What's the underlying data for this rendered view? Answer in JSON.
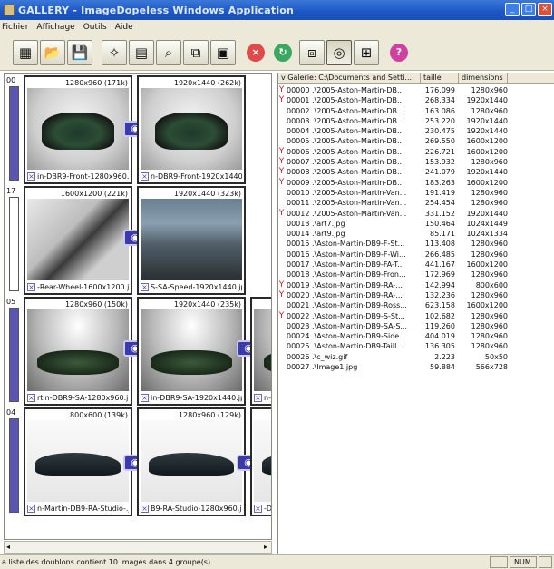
{
  "window": {
    "title": "GALLERY - ImageDopeless Windows Application",
    "buttons": [
      "_",
      "□",
      "×"
    ]
  },
  "menu": [
    "Fichier",
    "Affichage",
    "Outils",
    "Aide"
  ],
  "toolbar": {
    "icons": [
      "new-icon",
      "open-folder-icon",
      "save-disk-icon",
      "wand-icon",
      "image-list-icon",
      "find-icon",
      "compare-icon",
      "slideshow-icon",
      "stop-icon",
      "refresh-icon",
      "view-pair-icon",
      "view-glasses-icon",
      "view-mark-icon",
      "help-icon"
    ]
  },
  "groups": [
    {
      "number": "00",
      "bar_filled": true,
      "thumbs": [
        {
          "dim": "1280x960 (171k)",
          "fname": "in-DBR9-Front-1280x960.jpg",
          "img": "studio-car"
        },
        {
          "dim": "1920x1440 (262k)",
          "fname": "n-DBR9-Front-1920x1440.jpg",
          "img": "studio-car"
        }
      ]
    },
    {
      "number": "17",
      "bar_filled": false,
      "thumbs": [
        {
          "dim": "1600x1200 (221k)",
          "fname": "-Rear-Wheel-1600x1200.jpg",
          "img": "wheel"
        },
        {
          "dim": "1920x1440 (323k)",
          "fname": "S-SA-Speed-1920x1440.jpg",
          "img": "road"
        }
      ]
    },
    {
      "number": "05",
      "bar_filled": true,
      "thumbs": [
        {
          "dim": "1280x960 (150k)",
          "fname": "rtin-DBR9-SA-1280x960.jpg",
          "img": "sa"
        },
        {
          "dim": "1920x1440 (235k)",
          "fname": "in-DBR9-SA-1920x1440.jpg",
          "img": "sa"
        },
        {
          "dim": "",
          "fname": "n-DI",
          "img": "sa"
        }
      ]
    },
    {
      "number": "04",
      "bar_filled": true,
      "thumbs": [
        {
          "dim": "800x600 (139k)",
          "fname": "n-Martin-DB9-RA-Studio-.jpg",
          "img": "side-car"
        },
        {
          "dim": "1280x960 (129k)",
          "fname": "B9-RA-Studio-1280x960.jpg",
          "img": "side-car"
        },
        {
          "dim": "",
          "fname": "-DB",
          "img": "side-car"
        }
      ]
    }
  ],
  "table": {
    "headers": [
      "Galerie: C:\\Documents and Setti...",
      "taille",
      "dimensions"
    ],
    "rows": [
      {
        "chk": "Y",
        "num": "00000",
        "path": ".\\2005-Aston-Martin-DB...",
        "size": "176.099",
        "dim": "1280x960"
      },
      {
        "chk": "Y",
        "num": "00001",
        "path": ".\\2005-Aston-Martin-DB...",
        "size": "268.334",
        "dim": "1920x1440"
      },
      {
        "chk": "",
        "num": "00002",
        "path": ".\\2005-Aston-Martin-DB...",
        "size": "163.086",
        "dim": "1280x960"
      },
      {
        "chk": "",
        "num": "00003",
        "path": ".\\2005-Aston-Martin-DB...",
        "size": "253.220",
        "dim": "1920x1440"
      },
      {
        "chk": "",
        "num": "00004",
        "path": ".\\2005-Aston-Martin-DB...",
        "size": "230.475",
        "dim": "1920x1440"
      },
      {
        "chk": "",
        "num": "00005",
        "path": ".\\2005-Aston-Martin-DB...",
        "size": "269.550",
        "dim": "1600x1200"
      },
      {
        "chk": "Y",
        "num": "00006",
        "path": ".\\2005-Aston-Martin-DB...",
        "size": "226.721",
        "dim": "1600x1200"
      },
      {
        "chk": "Y",
        "num": "00007",
        "path": ".\\2005-Aston-Martin-DB...",
        "size": "153.932",
        "dim": "1280x960"
      },
      {
        "chk": "Y",
        "num": "00008",
        "path": ".\\2005-Aston-Martin-DB...",
        "size": "241.079",
        "dim": "1920x1440"
      },
      {
        "chk": "Y",
        "num": "00009",
        "path": ".\\2005-Aston-Martin-DB...",
        "size": "183.263",
        "dim": "1600x1200"
      },
      {
        "chk": "",
        "num": "00010",
        "path": ".\\2005-Aston-Martin-Van...",
        "size": "191.419",
        "dim": "1280x960"
      },
      {
        "chk": "",
        "num": "00011",
        "path": ".\\2005-Aston-Martin-Van...",
        "size": "254.454",
        "dim": "1280x960"
      },
      {
        "chk": "Y",
        "num": "00012",
        "path": ".\\2005-Aston-Martin-Van...",
        "size": "331.152",
        "dim": "1920x1440"
      },
      {
        "chk": "",
        "num": "00013",
        "path": ".\\art7.jpg",
        "size": "150.464",
        "dim": "1024x1449"
      },
      {
        "chk": "",
        "num": "00014",
        "path": ".\\art9.jpg",
        "size": "85.171",
        "dim": "1024x1334"
      },
      {
        "chk": "",
        "num": "00015",
        "path": ".\\Aston-Martin-DB9-F-St...",
        "size": "113.408",
        "dim": "1280x960"
      },
      {
        "chk": "",
        "num": "00016",
        "path": ".\\Aston-Martin-DB9-F-Wi...",
        "size": "266.485",
        "dim": "1280x960"
      },
      {
        "chk": "",
        "num": "00017",
        "path": ".\\Aston-Martin-DB9-FA-T...",
        "size": "441.167",
        "dim": "1600x1200"
      },
      {
        "chk": "",
        "num": "00018",
        "path": ".\\Aston-Martin-DB9-Fron...",
        "size": "172.969",
        "dim": "1280x960"
      },
      {
        "chk": "Y",
        "num": "00019",
        "path": ".\\Aston-Martin-DB9-RA-...",
        "size": "142.994",
        "dim": "800x600"
      },
      {
        "chk": "Y",
        "num": "00020",
        "path": ".\\Aston-Martin-DB9-RA-...",
        "size": "132.236",
        "dim": "1280x960"
      },
      {
        "chk": "",
        "num": "00021",
        "path": ".\\Aston-Martin-DB9-Ross...",
        "size": "623.158",
        "dim": "1600x1200"
      },
      {
        "chk": "Y",
        "num": "00022",
        "path": ".\\Aston-Martin-DB9-S-St...",
        "size": "102.682",
        "dim": "1280x960"
      },
      {
        "chk": "",
        "num": "00023",
        "path": ".\\Aston-Martin-DB9-SA-S...",
        "size": "119.260",
        "dim": "1280x960"
      },
      {
        "chk": "",
        "num": "00024",
        "path": ".\\Aston-Martin-DB9-Side...",
        "size": "404.019",
        "dim": "1280x960"
      },
      {
        "chk": "",
        "num": "00025",
        "path": ".\\Aston-Martin-DB9-Taill...",
        "size": "136.305",
        "dim": "1280x960"
      },
      {
        "chk": "",
        "num": "00026",
        "path": ".\\c_wiz.gif",
        "size": "2.223",
        "dim": "50x50"
      },
      {
        "chk": "",
        "num": "00027",
        "path": ".\\Image1.jpg",
        "size": "59.884",
        "dim": "566x728"
      }
    ]
  },
  "status": {
    "message": "a liste des doublons contient 10 images dans 4 groupe(s).",
    "num": "NUM"
  },
  "colors": {
    "titlebar": "#1d56c5",
    "group_bar": "#5a55b0",
    "check": "#c02020"
  }
}
